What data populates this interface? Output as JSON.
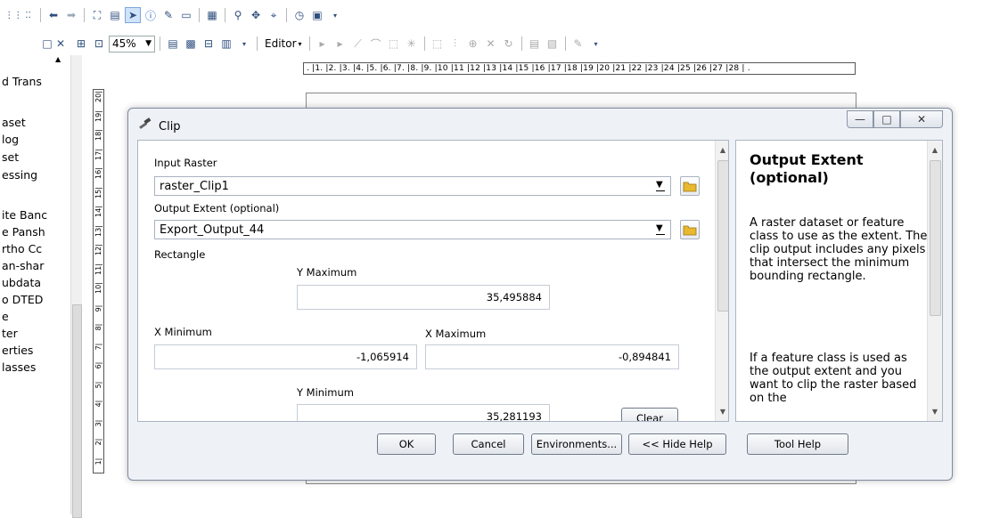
{
  "toolbar": {
    "zoom_value": "45%",
    "editor_label": "Editor"
  },
  "ruler": {
    "h_labels": ". |1. |2. |3. |4. |5. |6. |7. |8. |9. |10 |11 |12 |13 |14 |15 |16 |17 |18 |19 |20 |21 |22 |23 |24 |25 |26 |27 |28 | .",
    "v_labels": [
      "20",
      "19",
      "18",
      "17",
      "16",
      "15",
      "14",
      "13",
      "12",
      "11",
      "10",
      "9",
      "8",
      "7",
      "6",
      "5",
      "4",
      "3",
      "2",
      "1"
    ]
  },
  "left_panel": {
    "items": [
      "d Trans",
      "aset",
      "log",
      "set",
      "essing",
      "ite Banc",
      "e Pansh",
      "rtho Cc",
      "an-shar",
      "ubdata",
      "o DTED",
      "e",
      "ter",
      "erties",
      "lasses"
    ]
  },
  "dialog": {
    "title": "Clip",
    "input_raster_label": "Input Raster",
    "input_raster_value": "raster_Clip1",
    "output_extent_label": "Output Extent (optional)",
    "output_extent_value": "Export_Output_44",
    "rectangle_label": "Rectangle",
    "y_max_label": "Y Maximum",
    "y_max_value": "35,495884",
    "x_min_label": "X Minimum",
    "x_min_value": "-1,065914",
    "x_max_label": "X Maximum",
    "x_max_value": "-0,894841",
    "y_min_label": "Y Minimum",
    "y_min_value": "35,281193",
    "clear_label": "Clear",
    "buttons": {
      "ok": "OK",
      "cancel": "Cancel",
      "environments": "Environments...",
      "hide_help": "<< Hide Help",
      "tool_help": "Tool Help"
    },
    "help": {
      "title": "Output Extent (optional)",
      "para1": "A raster dataset or feature class to use as the extent. The clip output includes any pixels that intersect the minimum bounding rectangle.",
      "para2": "If a feature class is used as the output extent and you want to clip the raster based on the"
    }
  },
  "icons": {
    "accent": "#2f5f9f",
    "folder_color": "#e8b830"
  }
}
